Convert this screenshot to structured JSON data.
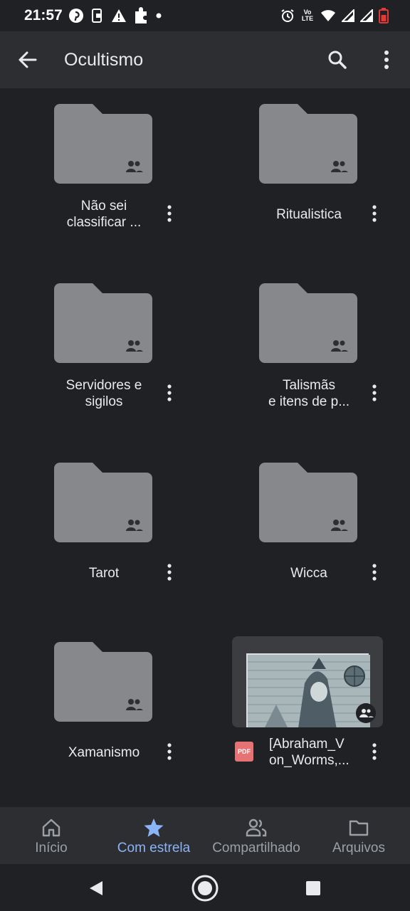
{
  "status_bar": {
    "time": "21:57",
    "left_icons": [
      "pinterest-icon",
      "phone-link-icon",
      "warning-icon",
      "puzzle-icon",
      "dot-icon"
    ],
    "right_icons": [
      "alarm-icon",
      "volte-icon",
      "wifi-icon",
      "signal-icon",
      "signal-icon",
      "battery-low-icon"
    ],
    "volte_text": "Vo\nLTE",
    "battery_color": "#e53935"
  },
  "app_bar": {
    "title": "Ocultismo",
    "back_icon": "arrow-left-icon",
    "search_icon": "search-icon",
    "more_icon": "more-vert-icon"
  },
  "folders": [
    {
      "name": "Não sei\nclassificar ...",
      "shared": true
    },
    {
      "name": "Ritualistica",
      "shared": true
    },
    {
      "name": "Servidores e\nsigilos",
      "shared": true
    },
    {
      "name": "Talismãs\ne itens de p...",
      "shared": true
    },
    {
      "name": "Tarot",
      "shared": true
    },
    {
      "name": "Wicca",
      "shared": true
    },
    {
      "name": "Xamanismo",
      "shared": true
    }
  ],
  "file": {
    "name": "[Abraham_V\non_Worms,...",
    "type_badge": "PDF",
    "badge_color": "#e57373",
    "shared": true
  },
  "bottom_nav": {
    "items": [
      {
        "label": "Início",
        "icon": "home-icon",
        "active": false
      },
      {
        "label": "Com estrela",
        "icon": "star-icon",
        "active": true
      },
      {
        "label": "Compartilhado",
        "icon": "people-icon",
        "active": false
      },
      {
        "label": "Arquivos",
        "icon": "folder-icon",
        "active": false
      }
    ],
    "active_color": "#8ab4f8"
  },
  "system_nav": {
    "buttons": [
      "back-triangle-icon",
      "home-circle-icon",
      "recents-square-icon"
    ]
  },
  "colors": {
    "background": "#202124",
    "app_bar": "#2d2e31",
    "folder": "#86888c"
  }
}
